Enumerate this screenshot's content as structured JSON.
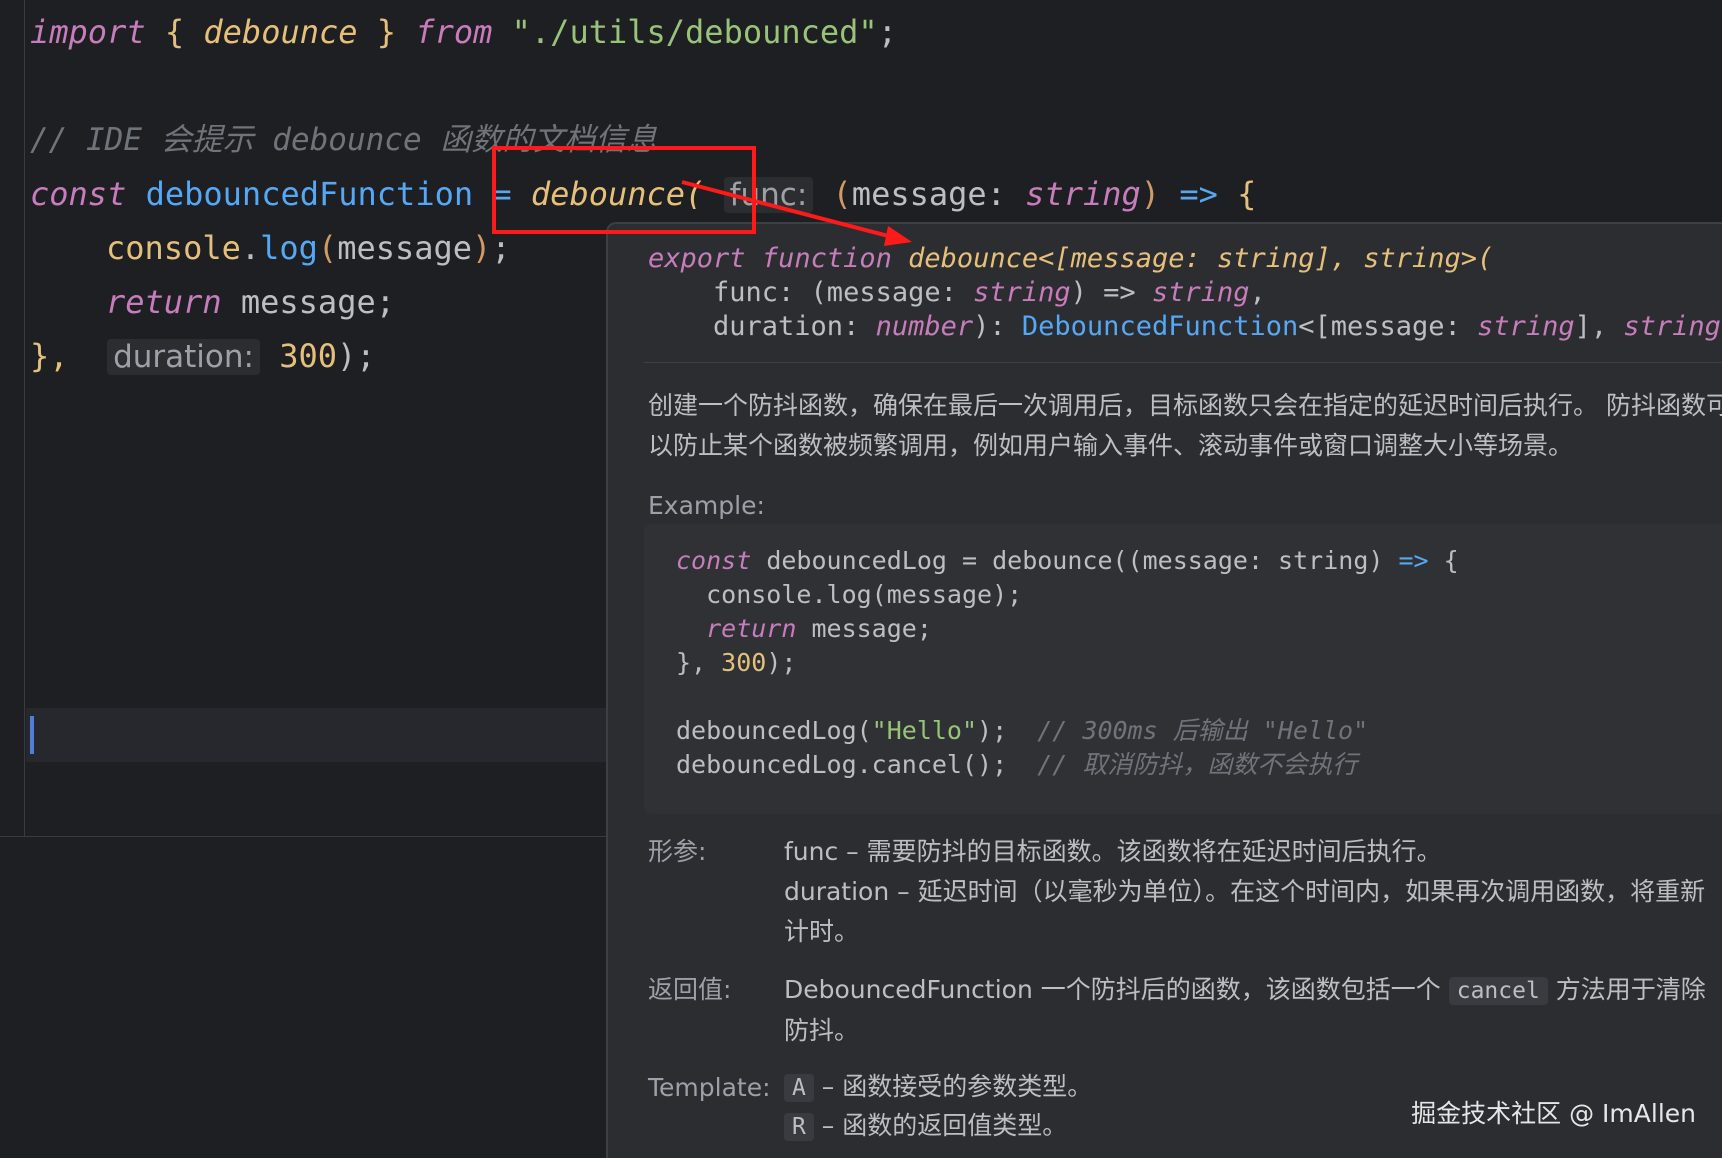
{
  "editor": {
    "line1": {
      "kw_import": "import",
      "brace_open": "{",
      "name": "debounce",
      "brace_close": "}",
      "kw_from": "from",
      "path": "\"./utils/debounced\"",
      "semi": ";"
    },
    "comment": "// IDE 会提示 debounce 函数的文档信息",
    "line3": {
      "kw_const": "const",
      "var_name": "debouncedFunction",
      "eq": "=",
      "call_name": "debounce",
      "paren": "(",
      "hint_func": "func:",
      "params_open": "(",
      "param_name": "message:",
      "param_type": "string",
      "params_close": ")",
      "arrow": "=>",
      "brace": "{"
    },
    "line4": {
      "obj": "console",
      "dot": ".",
      "method": "log",
      "paren_open": "(",
      "arg": "message",
      "paren_close": ")",
      "semi": ";"
    },
    "line5": {
      "kw_return": "return",
      "value": "message;"
    },
    "line6": {
      "close": "},",
      "hint_duration": "duration:",
      "num": "300",
      "end": ");"
    }
  },
  "popup": {
    "signature": {
      "line1_kw_export": "export",
      "line1_kw_function": "function",
      "line1_name": "debounce<[message: string], string>(",
      "line2_func": "    func: (message: ",
      "line2_type": "string",
      "line2_mid": ") => ",
      "line2_ret": "string",
      "line2_end": ",",
      "line3_duration": "    duration: ",
      "line3_type": "number",
      "line3_mid": "): ",
      "line3_cls": "DebouncedFunction",
      "line3_generic_open": "<[message: ",
      "line3_generic_type": "string",
      "line3_generic_mid": "], ",
      "line3_generic_ret": "string",
      "line3_generic_close": ">"
    },
    "description": "创建一个防抖函数，确保在最后一次调用后，目标函数只会在指定的延迟时间后执行。 防抖函数可以防止某个函数被频繁调用，例如用户输入事件、滚动事件或窗口调整大小等场景。",
    "example_label": "Example:",
    "example": {
      "l1_kw": "const",
      "l1_rest": " debouncedLog = debounce((message: string) ",
      "l1_arrow": "=>",
      "l1_end": " {",
      "l2": "  console.log(message);",
      "l3_kw": "  return",
      "l3_rest": " message;",
      "l4_start": "}, ",
      "l4_num": "300",
      "l4_end": ");",
      "l6_call": "debouncedLog(",
      "l6_str": "\"Hello\"",
      "l6_end": ");  ",
      "l6_comment": "// 300ms 后输出 \"Hello\"",
      "l7_call": "debouncedLog.cancel();  ",
      "l7_comment": "// 取消防抖，函数不会执行"
    },
    "params_label": "形参:",
    "param_func": "func – 需要防抖的目标函数。该函数将在延迟时间后执行。",
    "param_duration": "duration – 延迟时间（以毫秒为单位）。在这个时间内，如果再次调用函数，将重新计时。",
    "returns_label": "返回值:",
    "returns_pre": "DebouncedFunction 一个防抖后的函数，该函数包括一个 ",
    "returns_code": "cancel",
    "returns_post": " 方法用于清除防抖。",
    "template_label": "Template:",
    "template_a_code": "A",
    "template_a": " – 函数接受的参数类型。",
    "template_r_code": "R",
    "template_r": " – 函数的返回值类型。"
  },
  "watermark": "掘金技术社区 @ ImAllen",
  "colors": {
    "background": "#1e1f22",
    "popup_bg": "#2b2d30",
    "keyword": "#c77dbb",
    "function": "#e6c07b",
    "string": "#98c379",
    "identifier": "#56a8f5",
    "comment": "#6f737a",
    "annotation_red": "#ff1a1a",
    "caret": "#4f7ed9"
  }
}
